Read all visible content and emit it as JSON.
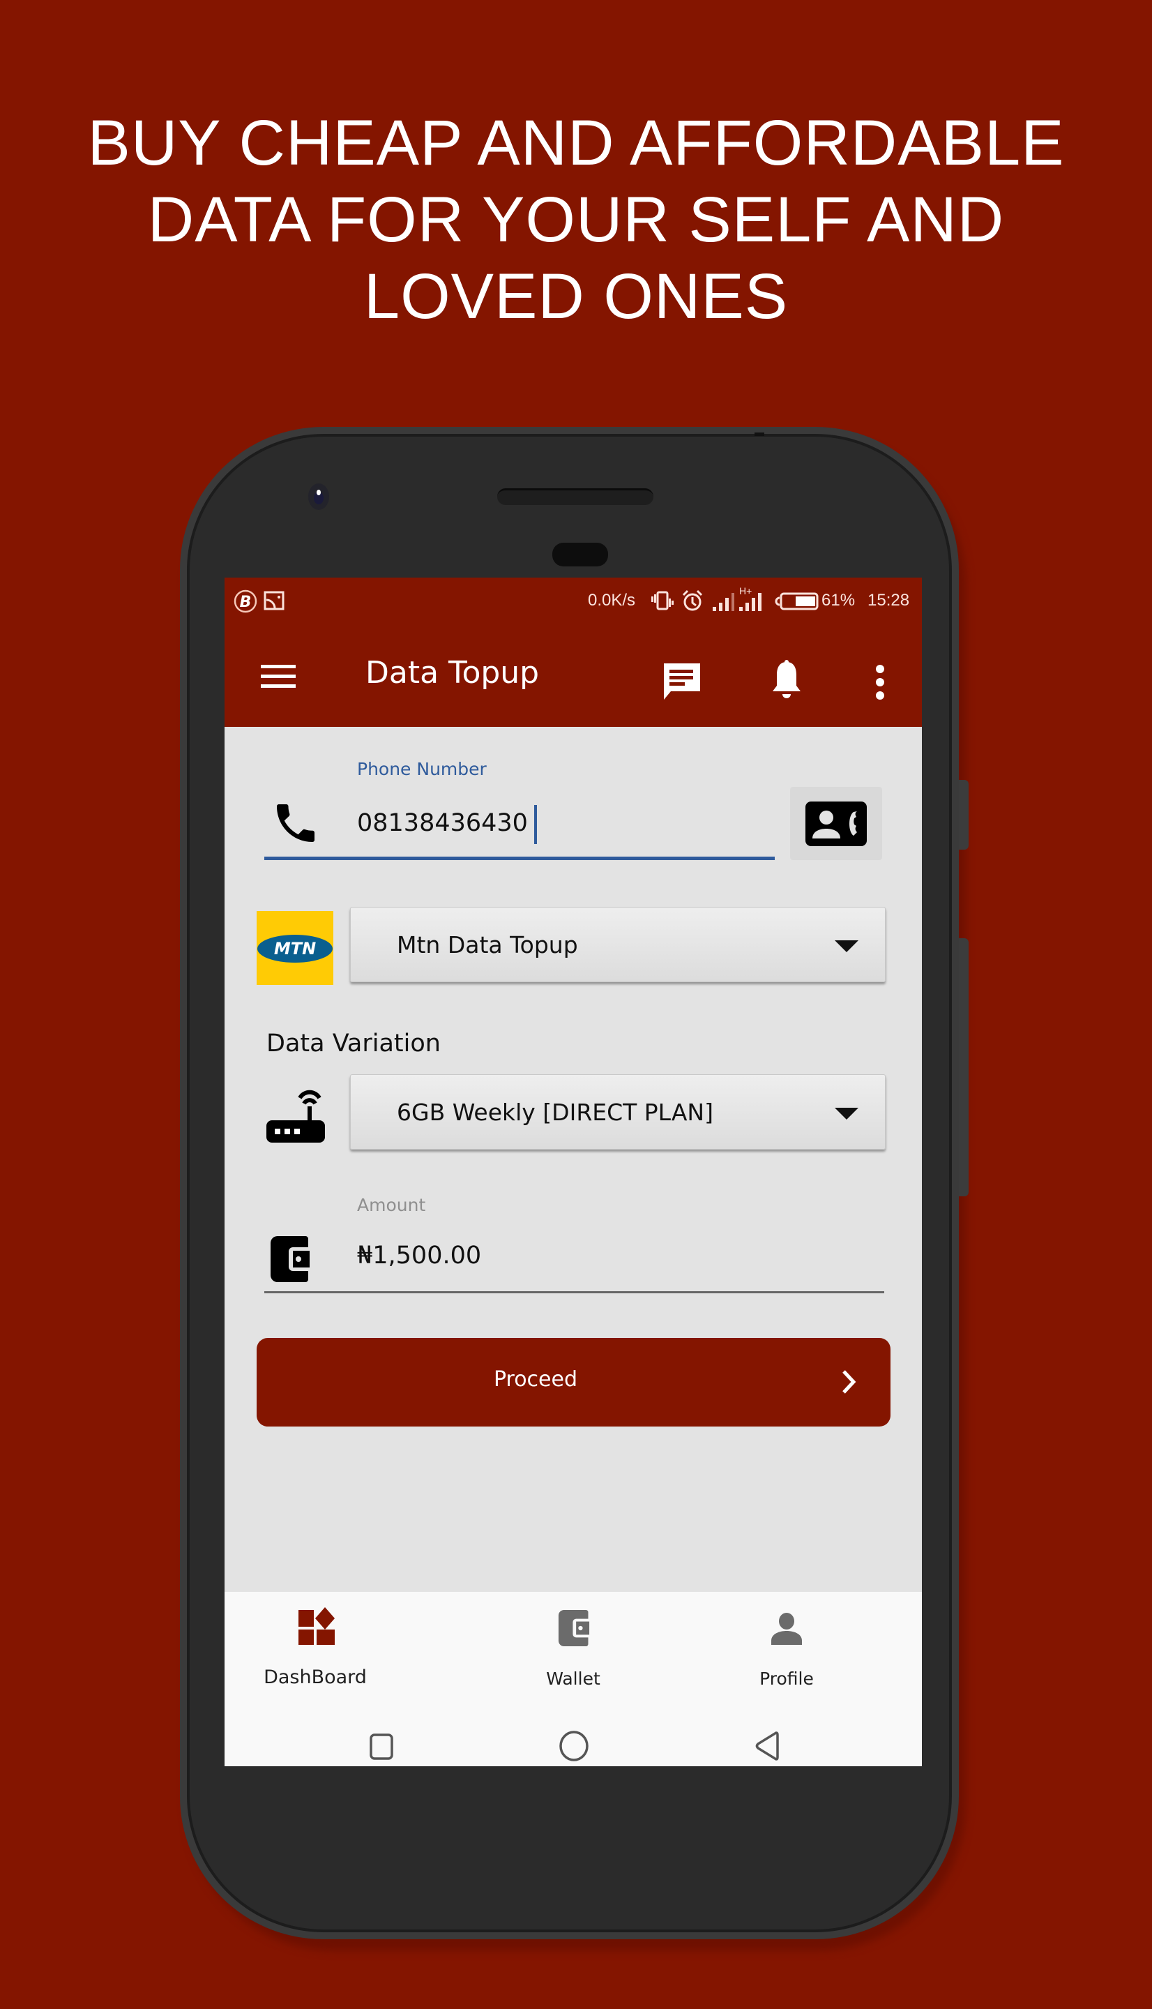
{
  "promo": {
    "headline_lines": [
      "BUY CHEAP AND AFFORDABLE",
      "DATA FOR YOUR SELF AND",
      "LOVED ONES"
    ]
  },
  "colors": {
    "brand": "#841500",
    "label_blue": "#2f5b9c",
    "mtn_yellow": "#ffcb05",
    "mtn_blue": "#0a5f8f"
  },
  "status_bar": {
    "left_icons": [
      "b-circle-icon",
      "cast-icon"
    ],
    "network_speed": "0.0K/s",
    "icons": [
      "vibrate-icon",
      "alarm-icon",
      "signal-icon",
      "signal-hplus-icon",
      "battery-icon"
    ],
    "network_type": "H+",
    "battery_percent": "61%",
    "battery_level": 0.61,
    "time": "15:28"
  },
  "app_bar": {
    "menu_icon": "hamburger-menu-icon",
    "title": "Data Topup",
    "actions": [
      "message-icon",
      "bell-icon",
      "more-vert-icon"
    ]
  },
  "form": {
    "phone": {
      "label": "Phone Number",
      "value": "08138436430",
      "icon": "phone-icon",
      "contact_button_icon": "contact-phone-icon"
    },
    "network": {
      "logo_text": "MTN",
      "selected": "Mtn Data Topup"
    },
    "data_variation": {
      "label": "Data Variation",
      "icon": "router-icon",
      "selected": "6GB Weekly [DIRECT PLAN]"
    },
    "amount": {
      "label": "Amount",
      "icon": "wallet-icon",
      "value": "₦1,500.00"
    },
    "proceed_label": "Proceed"
  },
  "bottom_nav": {
    "items": [
      {
        "label": "DashBoard",
        "icon": "dashboard-icon",
        "active": true
      },
      {
        "label": "Wallet",
        "icon": "wallet-icon",
        "active": false
      },
      {
        "label": "Profile",
        "icon": "person-icon",
        "active": false
      }
    ]
  },
  "system_nav": [
    "recents-icon",
    "home-icon",
    "back-icon"
  ]
}
